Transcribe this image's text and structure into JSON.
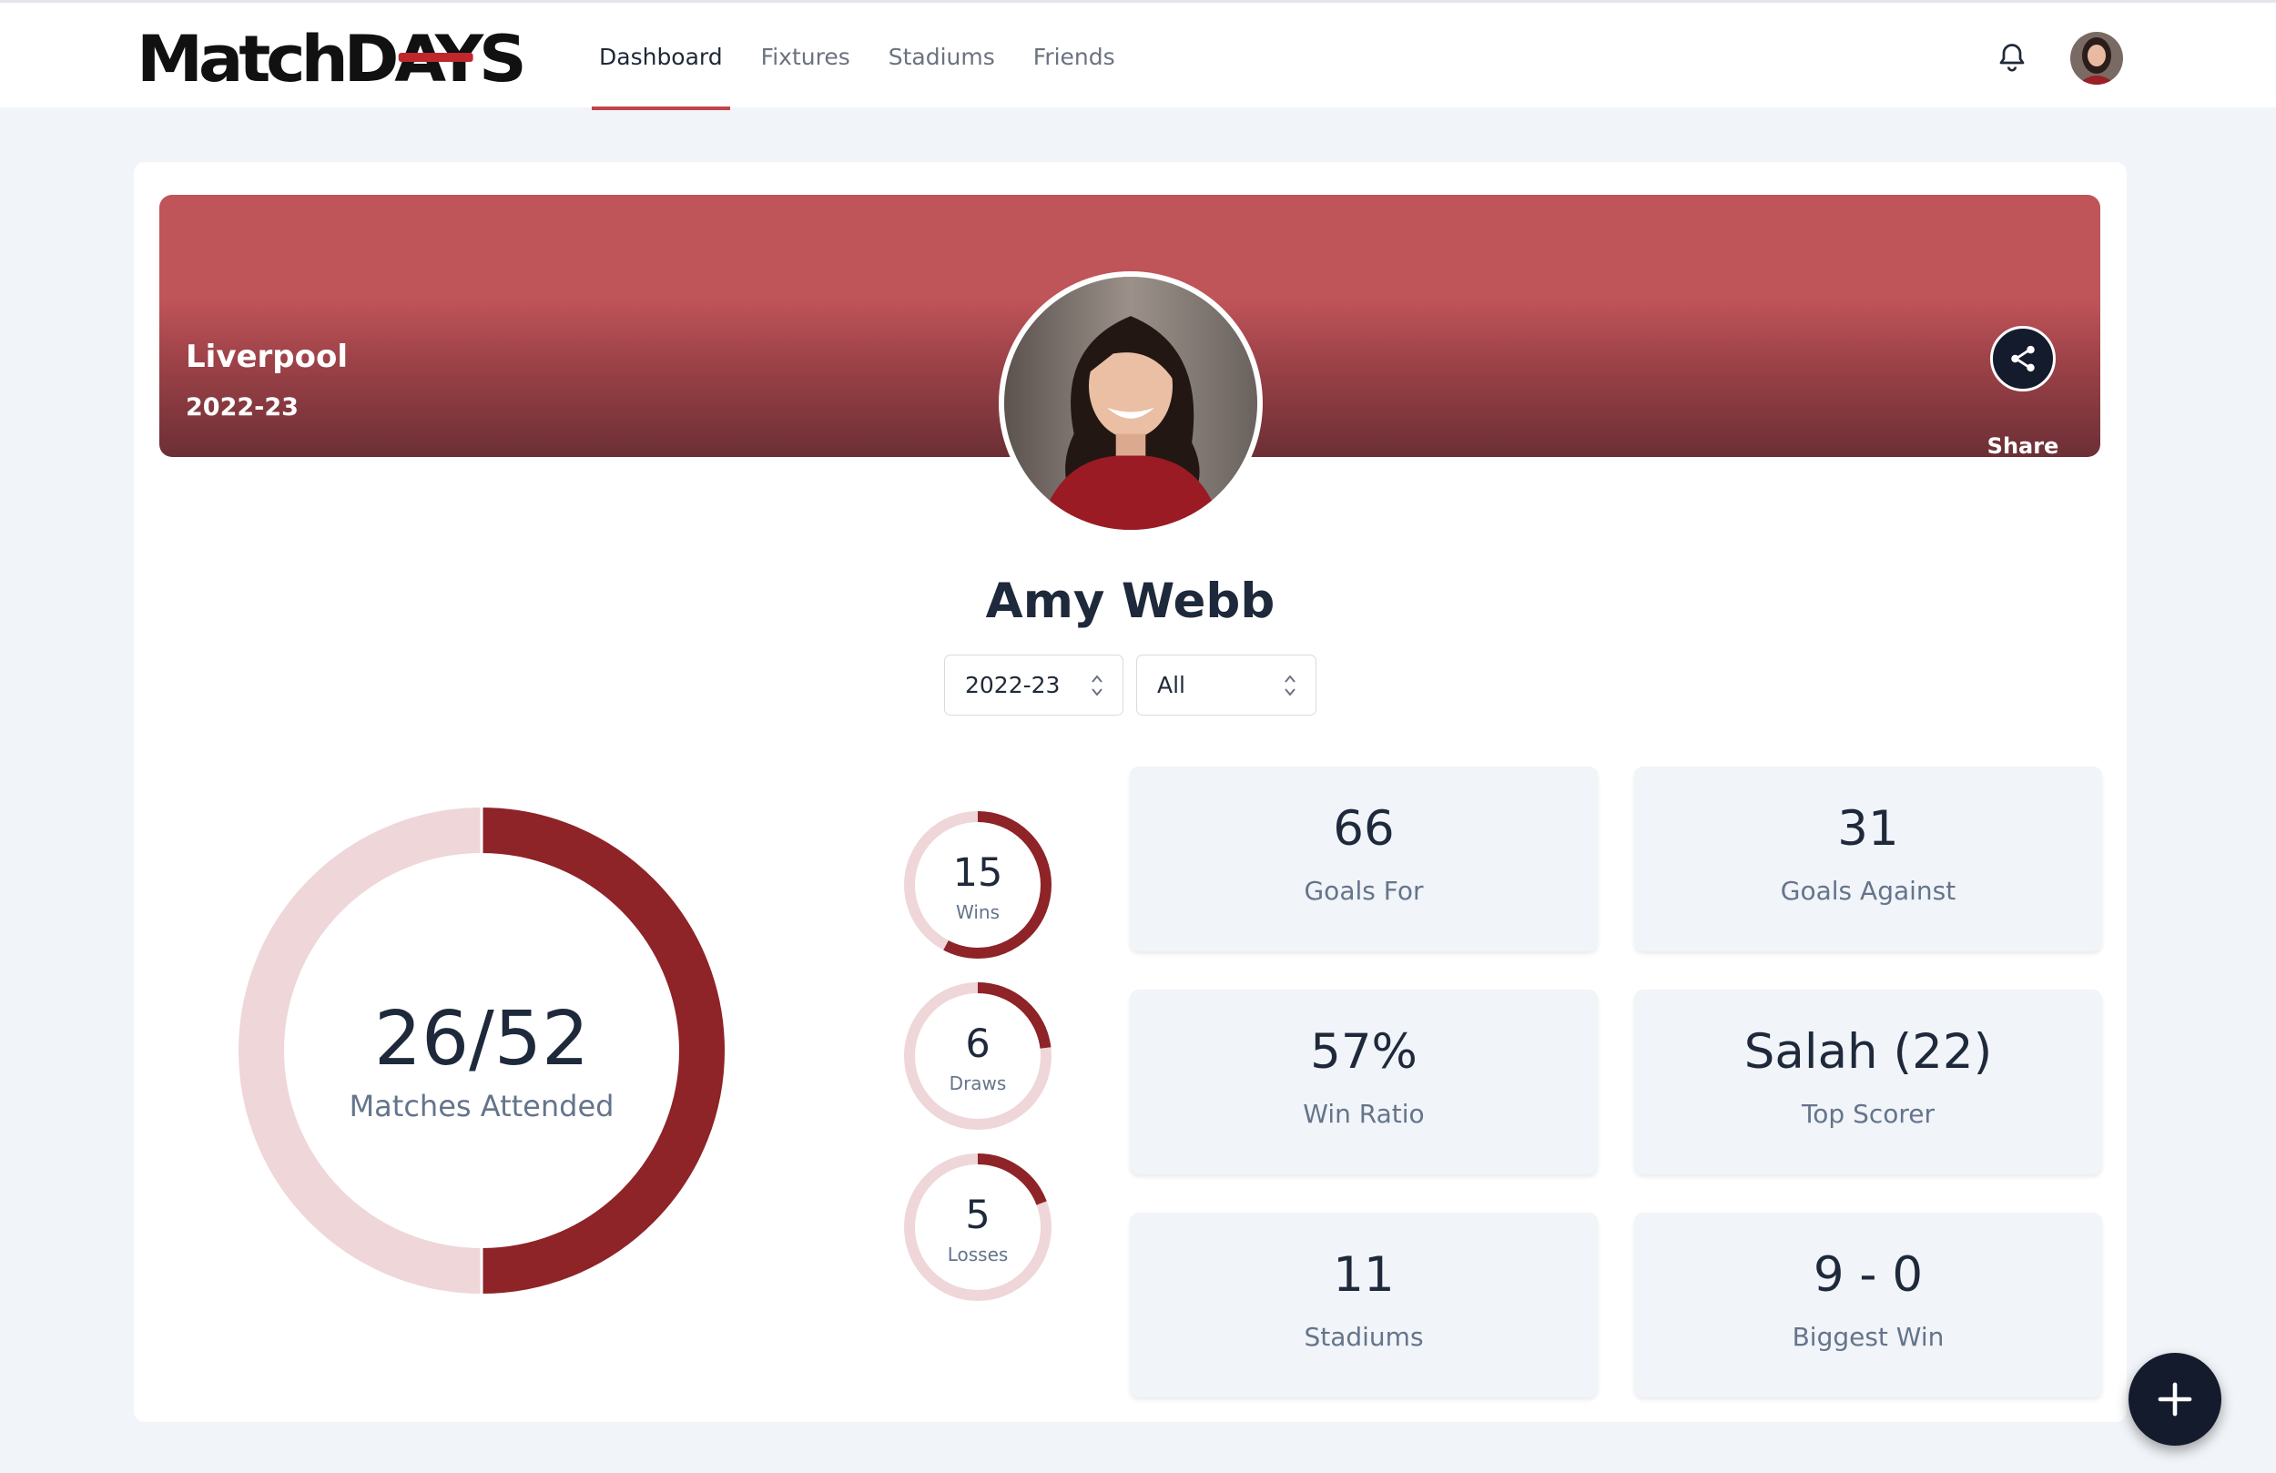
{
  "app": {
    "logo_text_1": "MatchD",
    "logo_text_2": "AY",
    "logo_text_3": "S"
  },
  "nav": {
    "items": [
      "Dashboard",
      "Fixtures",
      "Stadiums",
      "Friends"
    ],
    "active": "Dashboard"
  },
  "header_icons": {
    "notifications": "bell-icon",
    "avatar": "user-avatar"
  },
  "banner": {
    "team": "Liverpool",
    "season": "2022-23",
    "share_label": "Share",
    "share_icon": "share-icon"
  },
  "profile": {
    "name": "Amy Webb"
  },
  "filters": {
    "season_value": "2022-23",
    "competition_value": "All"
  },
  "attendance": {
    "value": "26/52",
    "label": "Matches Attended",
    "attended": 26,
    "total": 52
  },
  "results": [
    {
      "value": "15",
      "label": "Wins",
      "count": 15,
      "total": 26
    },
    {
      "value": "6",
      "label": "Draws",
      "count": 6,
      "total": 26
    },
    {
      "value": "5",
      "label": "Losses",
      "count": 5,
      "total": 26
    }
  ],
  "stats": [
    {
      "value": "66",
      "label": "Goals For"
    },
    {
      "value": "31",
      "label": "Goals Against"
    },
    {
      "value": "57%",
      "label": "Win Ratio"
    },
    {
      "value": "Salah (22)",
      "label": "Top Scorer"
    },
    {
      "value": "11",
      "label": "Stadiums"
    },
    {
      "value": "9 - 0",
      "label": "Biggest Win"
    }
  ],
  "fab": {
    "icon": "plus-icon"
  },
  "colors": {
    "accent": "#8e2328",
    "accent_light": "#efd6d8",
    "banner_top": "#bf5459",
    "dark": "#141b2d",
    "card_bg": "#f1f4f8"
  }
}
